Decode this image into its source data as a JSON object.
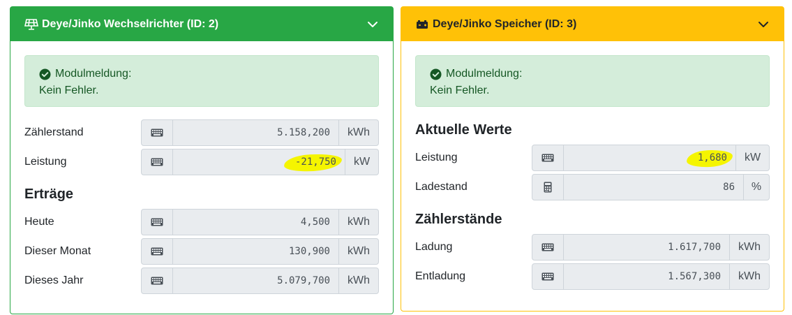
{
  "inverter": {
    "title": "Deye/Jinko Wechselrichter (ID: 2)",
    "header_icon": "solar-panel-icon",
    "accent": "#28a745",
    "alert": {
      "label": "Modulmeldung:",
      "message": "Kein Fehler."
    },
    "rows": [
      {
        "label": "Zählerstand",
        "value": "5.158,200",
        "unit": "kWh"
      },
      {
        "label": "Leistung",
        "value": "-21,750",
        "unit": "kW",
        "highlighted": true
      }
    ],
    "yields_title": "Erträge",
    "yields": [
      {
        "label": "Heute",
        "value": "4,500",
        "unit": "kWh"
      },
      {
        "label": "Dieser Monat",
        "value": "130,900",
        "unit": "kWh"
      },
      {
        "label": "Dieses Jahr",
        "value": "5.079,700",
        "unit": "kWh"
      }
    ]
  },
  "storage": {
    "title": "Deye/Jinko Speicher (ID: 3)",
    "header_icon": "battery-icon",
    "accent": "#ffc107",
    "alert": {
      "label": "Modulmeldung:",
      "message": "Kein Fehler."
    },
    "current_title": "Aktuelle Werte",
    "current": [
      {
        "label": "Leistung",
        "value": "1,680",
        "unit": "kW",
        "highlighted": true
      },
      {
        "label": "Ladestand",
        "value": "86",
        "unit": "%"
      }
    ],
    "meters_title": "Zählerstände",
    "meters": [
      {
        "label": "Ladung",
        "value": "1.617,700",
        "unit": "kWh"
      },
      {
        "label": "Entladung",
        "value": "1.567,300",
        "unit": "kWh"
      }
    ]
  },
  "icons": {
    "keyboard": "keyboard-icon",
    "calculator": "calculator-icon",
    "check": "check-circle-icon",
    "chevron": "chevron-down-icon"
  }
}
